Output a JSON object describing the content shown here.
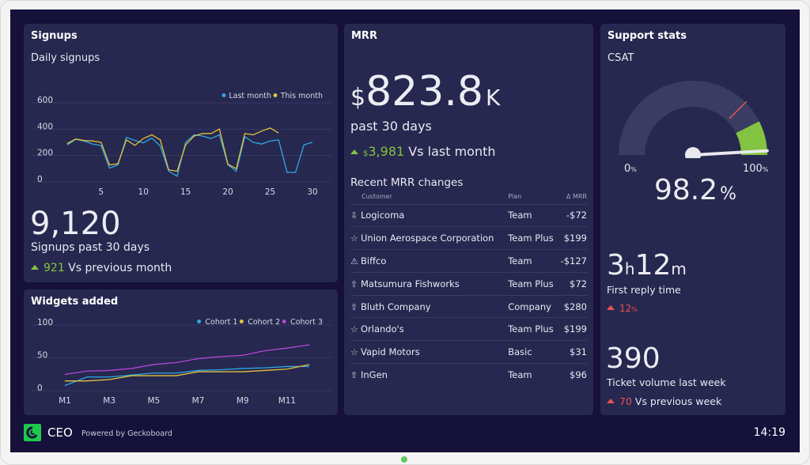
{
  "signups": {
    "title": "Signups",
    "chart_title": "Daily signups",
    "value": "9,120",
    "label": "Signups past 30 days",
    "delta": "921",
    "delta_text": "Vs previous month"
  },
  "widgets": {
    "title": "Widgets added"
  },
  "mrr": {
    "title": "MRR",
    "prefix": "$",
    "value": "823.8",
    "suffix": "K",
    "label": "past 30 days",
    "delta_prefix": "$",
    "delta": "3,981",
    "delta_text": "Vs last month",
    "table_title": "Recent MRR changes",
    "headers": [
      "Customer",
      "Plan",
      "Δ MRR"
    ],
    "rows": [
      {
        "icon": "arrow-down",
        "customer": "Logicoma",
        "plan": "Team",
        "delta": "-$72"
      },
      {
        "icon": "star",
        "customer": "Union Aerospace Corporation",
        "plan": "Team Plus",
        "delta": "$199"
      },
      {
        "icon": "warning",
        "customer": "Biffco",
        "plan": "Team",
        "delta": "-$127"
      },
      {
        "icon": "arrow-up",
        "customer": "Matsumura Fishworks",
        "plan": "Team Plus",
        "delta": "$72"
      },
      {
        "icon": "arrow-up",
        "customer": "Bluth Company",
        "plan": "Company",
        "delta": "$280"
      },
      {
        "icon": "star",
        "customer": "Orlando's",
        "plan": "Team Plus",
        "delta": "$199"
      },
      {
        "icon": "star",
        "customer": "Vapid Motors",
        "plan": "Basic",
        "delta": "$31"
      },
      {
        "icon": "arrow-up",
        "customer": "InGen",
        "plan": "Team",
        "delta": "$96"
      }
    ]
  },
  "support": {
    "title": "Support stats",
    "csat_label": "CSAT",
    "gauge_min": "0",
    "gauge_max": "100",
    "pct": "%",
    "csat_value": "98.2",
    "csat": 98.2,
    "target": 75,
    "green_from": 85,
    "reply_h": "3",
    "reply_h_unit": "h",
    "reply_m": "12",
    "reply_m_unit": "m",
    "reply_label": "First reply time",
    "reply_delta": "12",
    "reply_delta_unit": "%",
    "tickets": "390",
    "tickets_label": "Ticket volume last week",
    "tickets_delta": "70",
    "tickets_delta_text": "Vs previous week"
  },
  "footer": {
    "name": "CEO",
    "powered": "Powered by Geckoboard",
    "time": "14:19"
  },
  "colors": {
    "blue": "#2ea7e6",
    "yellow": "#e2c23a",
    "purple": "#b445d8",
    "green": "#82c341",
    "red": "#e9534f",
    "needle": "#e8e8ee"
  },
  "chart_data": [
    {
      "type": "line",
      "title": "Daily signups",
      "ylim": [
        0,
        600
      ],
      "yticks": [
        0,
        200,
        400,
        600
      ],
      "xticks": [
        5,
        10,
        15,
        20,
        25,
        30
      ],
      "legend": "top-right",
      "grid": true,
      "x": [
        1,
        2,
        3,
        4,
        5,
        6,
        7,
        8,
        9,
        10,
        11,
        12,
        13,
        14,
        15,
        16,
        17,
        18,
        19,
        20,
        21,
        22,
        23,
        24,
        25,
        26,
        27,
        28,
        29,
        30
      ],
      "series": [
        {
          "name": "Last month",
          "color": "#2ea7e6",
          "values": [
            257,
            299,
            286,
            263,
            251,
            80,
            105,
            314,
            290,
            272,
            309,
            248,
            57,
            19,
            276,
            333,
            324,
            305,
            333,
            105,
            57,
            320,
            276,
            263,
            286,
            295,
            48,
            48,
            257,
            276
          ]
        },
        {
          "name": "This month",
          "color": "#e2c23a",
          "values": [
            267,
            301,
            290,
            286,
            276,
            105,
            114,
            295,
            253,
            305,
            333,
            295,
            67,
            57,
            257,
            324,
            343,
            343,
            377,
            110,
            76,
            343,
            333,
            362,
            385,
            347
          ]
        }
      ]
    },
    {
      "type": "line",
      "title": "Widgets added",
      "ylim": [
        0,
        100
      ],
      "yticks": [
        0,
        50,
        100
      ],
      "categories": [
        "M1",
        "M2",
        "M3",
        "M4",
        "M5",
        "M6",
        "M7",
        "M8",
        "M9",
        "M10",
        "M11",
        "M12"
      ],
      "xticks": [
        "M1",
        "M3",
        "M5",
        "M7",
        "M9",
        "M11"
      ],
      "legend": "top-right",
      "grid": true,
      "series": [
        {
          "name": "Cohort 1",
          "color": "#2ea7e6",
          "values": [
            3,
            16,
            16,
            19,
            22,
            22,
            26,
            27,
            29,
            30,
            32,
            32
          ]
        },
        {
          "name": "Cohort 2",
          "color": "#e2c23a",
          "values": [
            10,
            10,
            12,
            18,
            18,
            18,
            24,
            24,
            24,
            26,
            28,
            35
          ]
        },
        {
          "name": "Cohort 3",
          "color": "#b445d8",
          "values": [
            20,
            25,
            26,
            29,
            35,
            38,
            44,
            47,
            49,
            56,
            60,
            65
          ]
        }
      ]
    }
  ]
}
